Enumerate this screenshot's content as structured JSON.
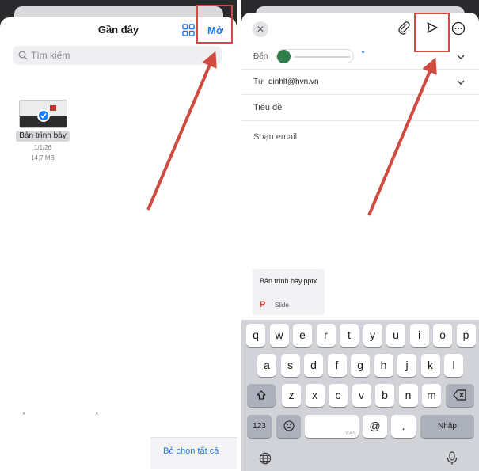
{
  "left_panel": {
    "title": "Gần đây",
    "open_button": "Mở",
    "search_placeholder": "Tìm kiếm",
    "file": {
      "name": "Bản trình bày",
      "date": "1/1/26",
      "size": "14,7 MB"
    },
    "deselect_all": "Bỏ chọn tất cả"
  },
  "right_panel": {
    "to_label": "Đến",
    "from_label": "Từ",
    "from_value": "dinhlt@hvn.vn",
    "subject_placeholder": "Tiêu đề",
    "body_placeholder": "Soạn email",
    "attachment": {
      "name": "Bản trình bày.pptx",
      "type": "Slide",
      "icon": "P"
    },
    "keyboard": {
      "row1": [
        "q",
        "w",
        "e",
        "r",
        "t",
        "y",
        "u",
        "i",
        "o",
        "p"
      ],
      "row2": [
        "a",
        "s",
        "d",
        "f",
        "g",
        "h",
        "j",
        "k",
        "l"
      ],
      "row3": [
        "z",
        "x",
        "c",
        "v",
        "b",
        "n",
        "m"
      ],
      "num_key": "123",
      "at_key": "@",
      "dot_key": ".",
      "return_key": "Nhập",
      "space_hint": "VI,EN"
    }
  },
  "colors": {
    "accent": "#1a7cf0",
    "highlight": "#d24a45",
    "arrow": "#cf4b3f"
  }
}
